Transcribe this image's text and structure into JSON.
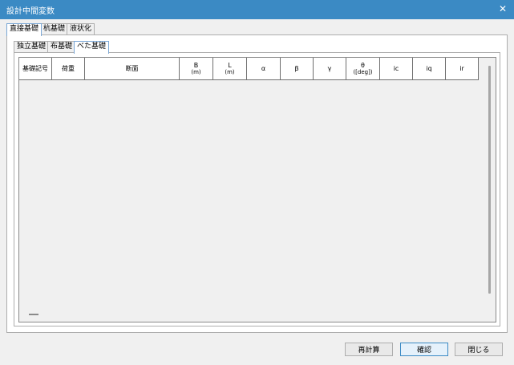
{
  "window": {
    "title": "設計中間変数",
    "close_glyph": "✕"
  },
  "outer_tabs": [
    {
      "label": "直接基礎",
      "active": true
    },
    {
      "label": "杭基礎",
      "active": false
    },
    {
      "label": "液状化",
      "active": false
    }
  ],
  "inner_tabs": [
    {
      "label": "独立基礎",
      "active": false
    },
    {
      "label": "布基礎",
      "active": false
    },
    {
      "label": "べた基礎",
      "active": true
    }
  ],
  "table": {
    "columns": [
      {
        "label": "基礎記号",
        "unit": ""
      },
      {
        "label": "荷重",
        "unit": ""
      },
      {
        "label": "断面",
        "unit": ""
      },
      {
        "label": "B",
        "unit": "(m)"
      },
      {
        "label": "L",
        "unit": "(m)"
      },
      {
        "label": "α",
        "unit": ""
      },
      {
        "label": "β",
        "unit": ""
      },
      {
        "label": "γ",
        "unit": ""
      },
      {
        "label": "θ",
        "unit": "([deg])"
      },
      {
        "label": "ic",
        "unit": ""
      },
      {
        "label": "iq",
        "unit": ""
      },
      {
        "label": "ir",
        "unit": ""
      }
    ],
    "rows": []
  },
  "buttons": {
    "recalc": "再計算",
    "confirm": "確認",
    "close": "閉じる"
  }
}
